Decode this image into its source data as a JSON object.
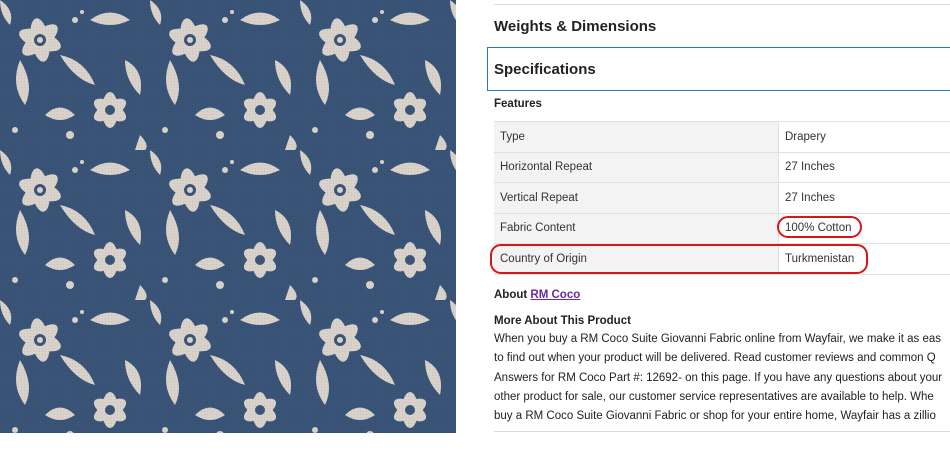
{
  "image": {
    "alt": "Blue and cream floral damask fabric"
  },
  "sections": {
    "weights": "Weights & Dimensions",
    "specifications": "Specifications"
  },
  "features": {
    "heading": "Features",
    "rows": [
      {
        "name": "Type",
        "value": "Drapery"
      },
      {
        "name": "Horizontal Repeat",
        "value": "27 Inches"
      },
      {
        "name": "Vertical Repeat",
        "value": "27 Inches"
      },
      {
        "name": "Fabric Content",
        "value": "100% Cotton"
      },
      {
        "name": "Country of Origin",
        "value": "Turkmenistan"
      }
    ]
  },
  "about": {
    "prefix": "About",
    "brand_link": "RM Coco"
  },
  "more": {
    "heading": "More About This Product",
    "lines": [
      "When you buy a RM Coco Suite Giovanni Fabric online from Wayfair, we make it as eas",
      "to find out when your product will be delivered. Read customer reviews and common Q",
      "Answers for RM Coco Part #: 12692- on this page. If you have any questions about your",
      "other product for sale, our customer service representatives are available to help. Whe",
      "buy a RM Coco Suite Giovanni Fabric or shop for your entire home, Wayfair has a zillio"
    ]
  },
  "colors": {
    "fabric_base": "#3a5478",
    "fabric_pattern": "#e6ddd3",
    "accent_blue": "#1e7bc8",
    "highlight_red": "#d41818",
    "link_purple": "#6a2aa3"
  }
}
